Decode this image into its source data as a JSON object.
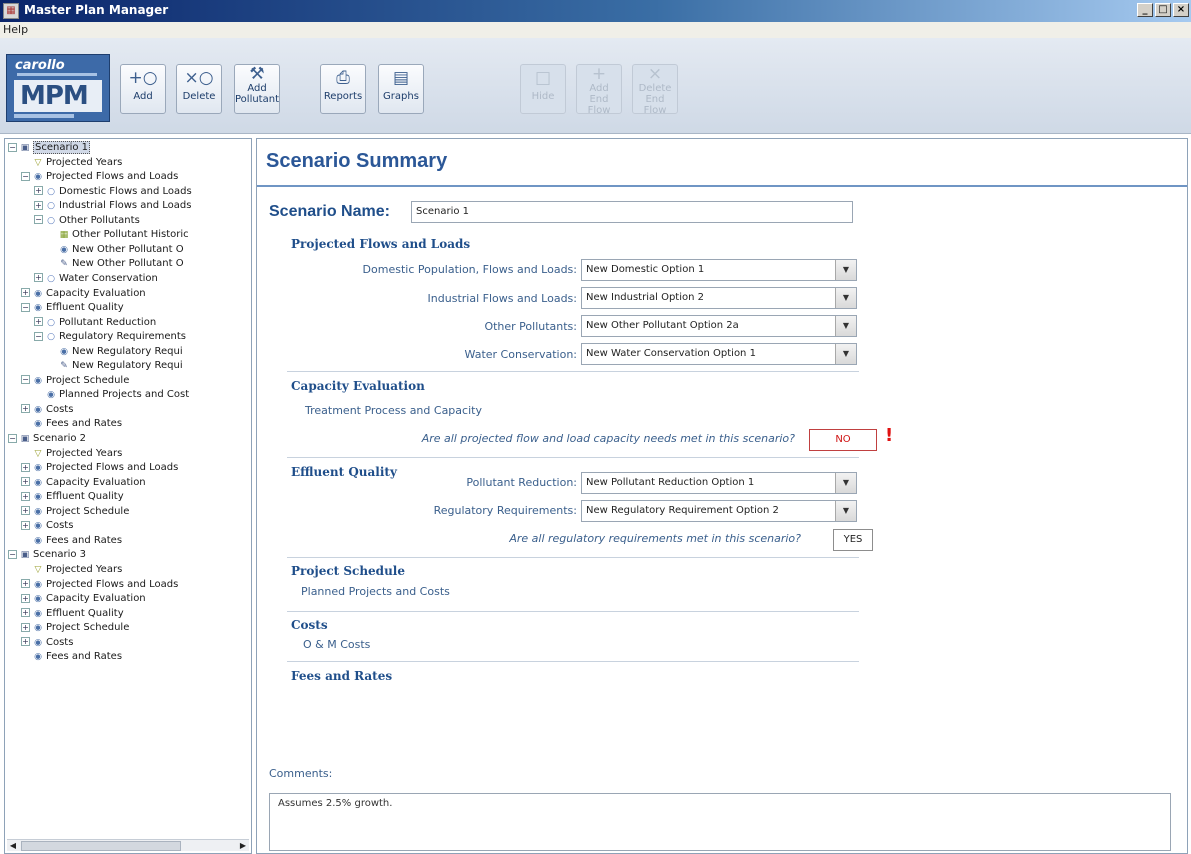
{
  "window": {
    "title": "Master Plan Manager",
    "controls": [
      "_",
      "□",
      "×"
    ]
  },
  "menu": {
    "help": "Help"
  },
  "logo": {
    "brand": "carollo",
    "mark": "MPM"
  },
  "toolbar": {
    "add": "Add",
    "delete": "Delete",
    "add_pollutant_1": "Add",
    "add_pollutant_2": "Pollutant",
    "reports": "Reports",
    "graphs": "Graphs",
    "hide": "Hide",
    "add_end_flow_1": "Add",
    "add_end_flow_2": "End Flow",
    "delete_end_flow_1": "Delete",
    "delete_end_flow_2": "End Flow"
  },
  "tree": [
    {
      "text": "Scenario 1",
      "exp": "−",
      "icon": "box",
      "level": 0,
      "selected": true
    },
    {
      "text": "Projected Years",
      "exp": "",
      "icon": "year",
      "level": 1
    },
    {
      "text": "Projected Flows and Loads",
      "exp": "−",
      "icon": "ring",
      "level": 1
    },
    {
      "text": "Domestic Flows and Loads",
      "exp": "+",
      "icon": "open",
      "level": 2
    },
    {
      "text": "Industrial Flows and Loads",
      "exp": "+",
      "icon": "open",
      "level": 2
    },
    {
      "text": "Other Pollutants",
      "exp": "−",
      "icon": "open",
      "level": 2
    },
    {
      "text": "Other Pollutant Historic",
      "exp": "",
      "icon": "green",
      "level": 3
    },
    {
      "text": "New Other Pollutant O",
      "exp": "",
      "icon": "ring",
      "level": 3
    },
    {
      "text": "New Other Pollutant O",
      "exp": "",
      "icon": "edit",
      "level": 3
    },
    {
      "text": "Water Conservation",
      "exp": "+",
      "icon": "open",
      "level": 2
    },
    {
      "text": "Capacity Evaluation",
      "exp": "+",
      "icon": "ring",
      "level": 1
    },
    {
      "text": "Effluent Quality",
      "exp": "−",
      "icon": "ring",
      "level": 1
    },
    {
      "text": "Pollutant Reduction",
      "exp": "+",
      "icon": "open",
      "level": 2
    },
    {
      "text": "Regulatory Requirements",
      "exp": "−",
      "icon": "open",
      "level": 2
    },
    {
      "text": "New Regulatory Requi",
      "exp": "",
      "icon": "ring",
      "level": 3
    },
    {
      "text": "New Regulatory Requi",
      "exp": "",
      "icon": "edit",
      "level": 3
    },
    {
      "text": "Project Schedule",
      "exp": "−",
      "icon": "ring",
      "level": 1
    },
    {
      "text": "Planned Projects and Cost",
      "exp": "",
      "icon": "ring",
      "level": 2
    },
    {
      "text": "Costs",
      "exp": "+",
      "icon": "ring",
      "level": 1
    },
    {
      "text": "Fees and Rates",
      "exp": "",
      "icon": "ring",
      "level": 1
    },
    {
      "text": "Scenario 2",
      "exp": "−",
      "icon": "box",
      "level": 0
    },
    {
      "text": "Projected Years",
      "exp": "",
      "icon": "year",
      "level": 1
    },
    {
      "text": "Projected Flows and Loads",
      "exp": "+",
      "icon": "ring",
      "level": 1
    },
    {
      "text": "Capacity Evaluation",
      "exp": "+",
      "icon": "ring",
      "level": 1
    },
    {
      "text": "Effluent Quality",
      "exp": "+",
      "icon": "ring",
      "level": 1
    },
    {
      "text": "Project Schedule",
      "exp": "+",
      "icon": "ring",
      "level": 1
    },
    {
      "text": "Costs",
      "exp": "+",
      "icon": "ring",
      "level": 1
    },
    {
      "text": "Fees and Rates",
      "exp": "",
      "icon": "ring",
      "level": 1
    },
    {
      "text": "Scenario 3",
      "exp": "−",
      "icon": "box",
      "level": 0
    },
    {
      "text": "Projected Years",
      "exp": "",
      "icon": "year",
      "level": 1
    },
    {
      "text": "Projected Flows and Loads",
      "exp": "+",
      "icon": "ring",
      "level": 1
    },
    {
      "text": "Capacity Evaluation",
      "exp": "+",
      "icon": "ring",
      "level": 1
    },
    {
      "text": "Effluent Quality",
      "exp": "+",
      "icon": "ring",
      "level": 1
    },
    {
      "text": "Project Schedule",
      "exp": "+",
      "icon": "ring",
      "level": 1
    },
    {
      "text": "Costs",
      "exp": "+",
      "icon": "ring",
      "level": 1
    },
    {
      "text": "Fees and Rates",
      "exp": "",
      "icon": "ring",
      "level": 1
    }
  ],
  "main": {
    "title": "Scenario Summary",
    "scenario_name_label": "Scenario Name:",
    "scenario_name_value": "Scenario 1",
    "sections": {
      "flows": "Projected Flows and Loads",
      "capacity": "Capacity Evaluation",
      "effluent": "Effluent Quality",
      "schedule": "Project Schedule",
      "costs": "Costs",
      "fees": "Fees and Rates"
    },
    "fields": {
      "domestic_label": "Domestic Population, Flows and Loads:",
      "domestic_value": "New Domestic Option 1",
      "industrial_label": "Industrial Flows and Loads:",
      "industrial_value": "New Industrial Option 2",
      "other_label": "Other Pollutants:",
      "other_value": "New Other Pollutant Option 2a",
      "water_label": "Water Conservation:",
      "water_value": "New Water Conservation Option 1",
      "treatment_text": "Treatment Process and Capacity",
      "capacity_question": "Are all projected flow and load capacity needs met in this scenario?",
      "capacity_answer": "NO",
      "alert_mark": "!",
      "pollutant_label": "Pollutant Reduction:",
      "pollutant_value": "New Pollutant Reduction Option 1",
      "regulatory_label": "Regulatory Requirements:",
      "regulatory_value": "New Regulatory Requirement Option 2",
      "regulatory_question": "Are all regulatory requirements met in this scenario?",
      "regulatory_answer": "YES",
      "planned_text": "Planned Projects and Costs",
      "om_text": "O & M Costs"
    },
    "comments_label": "Comments:",
    "comments_value": "Assumes 2.5% growth."
  },
  "colors": {
    "accent": "#2b5797",
    "alert": "#e01010",
    "title_bar": "#0a246a"
  }
}
